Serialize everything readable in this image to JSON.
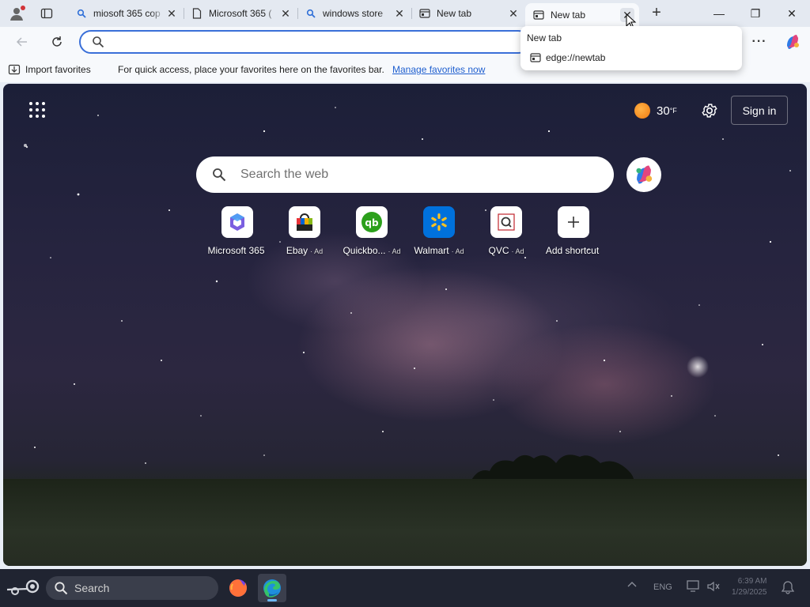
{
  "browser": {
    "tabs": [
      {
        "title": "miosoft 365 cop",
        "icon": "search-icon",
        "close": "✕"
      },
      {
        "title": "Microsoft 365 (",
        "icon": "page-icon",
        "close": "✕"
      },
      {
        "title": "windows store",
        "icon": "search-icon",
        "close": "✕"
      },
      {
        "title": "New tab",
        "icon": "newtab-icon",
        "close": "✕"
      },
      {
        "title": "New tab",
        "icon": "newtab-icon",
        "close": "✕",
        "active": true
      }
    ],
    "new_tab": "+",
    "window_controls": {
      "minimize": "—",
      "restore": "❐",
      "close": "✕"
    },
    "hover_card": {
      "title": "New tab",
      "url": "edge://newtab"
    },
    "address_bar": {
      "value": "",
      "placeholder": ""
    },
    "more_menu": "···",
    "favorites_bar": {
      "import_label": "Import favorites",
      "message": "For quick access, place your favorites here on the favorites bar.",
      "manage_link": "Manage favorites now"
    }
  },
  "newtab": {
    "weather": {
      "temp": "30",
      "unit": "°F"
    },
    "signin": "Sign in",
    "search_placeholder": "Search the web",
    "shortcuts": [
      {
        "label": "Microsoft 365",
        "ad": ""
      },
      {
        "label": "Ebay",
        "ad": "· Ad"
      },
      {
        "label": "Quickbo...",
        "ad": "· Ad"
      },
      {
        "label": "Walmart",
        "ad": "· Ad"
      },
      {
        "label": "QVC",
        "ad": "· Ad"
      },
      {
        "label": "Add shortcut",
        "ad": ""
      }
    ]
  },
  "taskbar": {
    "search_label": "Search",
    "tray": {
      "language": "ENG"
    },
    "clock": {
      "time": "6:39 AM",
      "date": "1/29/2025"
    }
  },
  "colors": {
    "accent": "#3a6fd8",
    "link": "#1f5fcf",
    "taskbar": "#202431"
  }
}
